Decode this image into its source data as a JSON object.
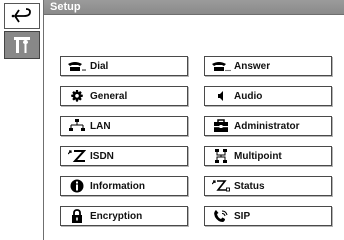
{
  "title": "Setup",
  "sidebar": {
    "items": [
      {
        "icon": "back-arrow-icon"
      },
      {
        "icon": "tools-icon"
      }
    ]
  },
  "buttons": [
    {
      "label": "Dial",
      "icon": "dial-icon"
    },
    {
      "label": "Answer",
      "icon": "answer-icon"
    },
    {
      "label": "General",
      "icon": "gear-icon"
    },
    {
      "label": "Audio",
      "icon": "speaker-icon"
    },
    {
      "label": "LAN",
      "icon": "network-icon"
    },
    {
      "label": "Administrator",
      "icon": "toolbox-icon"
    },
    {
      "label": "ISDN",
      "icon": "isdn-icon"
    },
    {
      "label": "Multipoint",
      "icon": "multipoint-icon"
    },
    {
      "label": "Information",
      "icon": "info-icon"
    },
    {
      "label": "Status",
      "icon": "status-icon"
    },
    {
      "label": "Encryption",
      "icon": "lock-icon"
    },
    {
      "label": "SIP",
      "icon": "sip-phone-icon"
    }
  ],
  "colors": {
    "titlebar": "#8f8f8f",
    "tools_button": "#888888",
    "border": "#4a4a4a"
  }
}
